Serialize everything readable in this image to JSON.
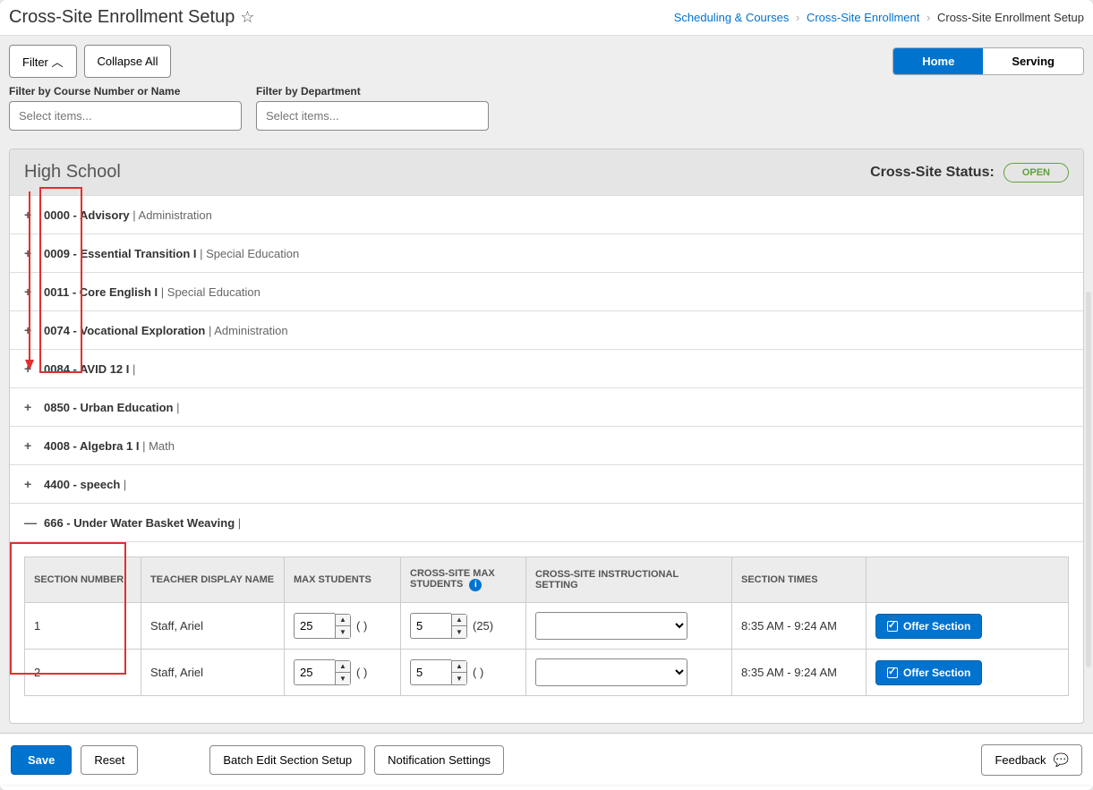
{
  "header": {
    "title": "Cross-Site Enrollment Setup",
    "breadcrumb": {
      "l1": "Scheduling & Courses",
      "l2": "Cross-Site Enrollment",
      "l3": "Cross-Site Enrollment Setup"
    }
  },
  "toolbar": {
    "filter_btn": "Filter",
    "collapse_btn": "Collapse All",
    "toggle": {
      "home": "Home",
      "serving": "Serving"
    },
    "filter_course_label": "Filter by Course Number or Name",
    "filter_dept_label": "Filter by Department",
    "placeholder": "Select items..."
  },
  "panel": {
    "school": "High School",
    "status_label": "Cross-Site Status:",
    "status_value": "OPEN"
  },
  "courses": [
    {
      "code": "0000",
      "name": "Advisory",
      "dept": "Administration",
      "icon": "plus"
    },
    {
      "code": "0009",
      "name": "Essential Transition I",
      "dept": "Special Education",
      "icon": "plus"
    },
    {
      "code": "0011",
      "name": "Core English I",
      "dept": "Special Education",
      "icon": "plus"
    },
    {
      "code": "0074",
      "name": "Vocational Exploration",
      "dept": "Administration",
      "icon": "plus"
    },
    {
      "code": "0084",
      "name": "AVID 12 I",
      "dept": "",
      "icon": "plus"
    },
    {
      "code": "0850",
      "name": "Urban Education",
      "dept": "",
      "icon": "plus"
    },
    {
      "code": "4008",
      "name": "Algebra 1 I",
      "dept": "Math",
      "icon": "plus"
    },
    {
      "code": "4400",
      "name": "speech",
      "dept": "",
      "icon": "plus"
    },
    {
      "code": "666",
      "name": "Under Water Basket Weaving",
      "dept": "",
      "icon": "minus"
    }
  ],
  "table": {
    "headers": {
      "section_number": "SECTION NUMBER",
      "teacher": "TEACHER DISPLAY NAME",
      "max": "MAX STUDENTS",
      "csmax": "CROSS-SITE MAX STUDENTS",
      "instr": "CROSS-SITE INSTRUCTIONAL SETTING",
      "times": "SECTION TIMES"
    },
    "rows": [
      {
        "num": "1",
        "teacher": "Staff, Ariel",
        "max": "25",
        "max_paren": "( )",
        "cs": "5",
        "cs_paren": "(25)",
        "times": "8:35 AM - 9:24 AM",
        "offer": "Offer Section"
      },
      {
        "num": "2",
        "teacher": "Staff, Ariel",
        "max": "25",
        "max_paren": "( )",
        "cs": "5",
        "cs_paren": "( )",
        "times": "8:35 AM - 9:24 AM",
        "offer": "Offer Section"
      }
    ]
  },
  "footer": {
    "save": "Save",
    "reset": "Reset",
    "batch": "Batch Edit Section Setup",
    "notif": "Notification Settings",
    "feedback": "Feedback"
  }
}
